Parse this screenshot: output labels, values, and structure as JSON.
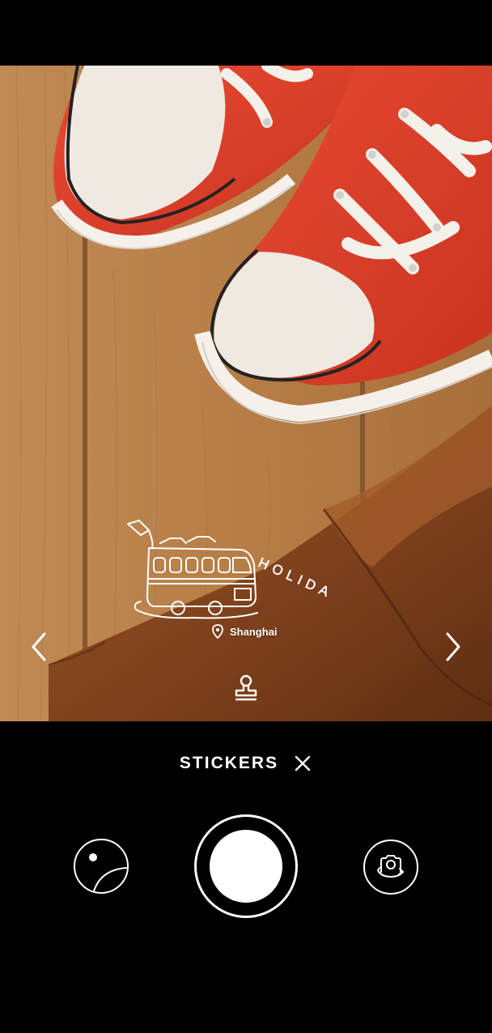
{
  "sticker": {
    "word": "HOLIDAY",
    "location": "Shanghai"
  },
  "mode": {
    "label": "STICKERS"
  },
  "icons": {
    "prev": "chevron-left-icon",
    "next": "chevron-right-icon",
    "location": "location-pin-icon",
    "stamp": "stamp-icon",
    "close": "close-icon",
    "gallery": "gallery-icon",
    "shutter": "shutter-icon",
    "flip": "camera-flip-icon"
  },
  "colors": {
    "wood": "#b9814b",
    "shoe_red": "#e0412f",
    "leather": "#8a4a22",
    "background": "#000000",
    "foreground": "#ffffff"
  }
}
